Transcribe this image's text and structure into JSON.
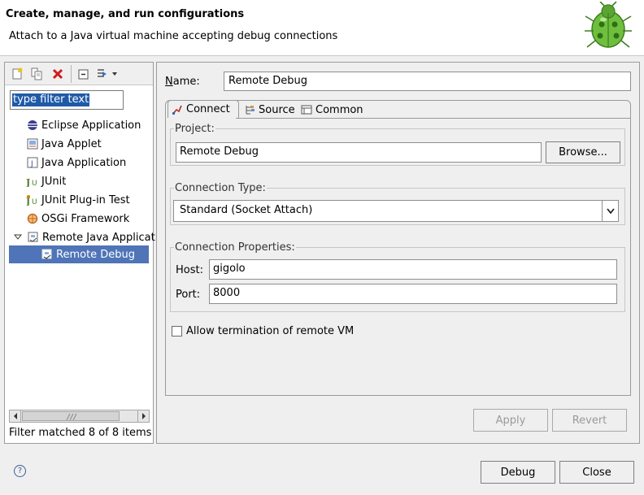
{
  "header": {
    "title": "Create, manage, and run configurations",
    "message": "Attach to a Java virtual machine accepting debug connections"
  },
  "left": {
    "filter_placeholder": "type filter text",
    "tree": [
      {
        "label": "Eclipse Application",
        "icon": "eclipse-app-icon"
      },
      {
        "label": "Java Applet",
        "icon": "java-applet-icon"
      },
      {
        "label": "Java Application",
        "icon": "java-app-icon"
      },
      {
        "label": "JUnit",
        "icon": "junit-icon"
      },
      {
        "label": "JUnit Plug-in Test",
        "icon": "junit-plugin-icon"
      },
      {
        "label": "OSGi Framework",
        "icon": "osgi-icon"
      },
      {
        "label": "Remote Java Applicati",
        "icon": "remote-java-icon"
      },
      {
        "label": "Remote Debug",
        "icon": "remote-debug-icon"
      }
    ],
    "status": "Filter matched 8 of 8 items"
  },
  "right": {
    "name_label": "Name:",
    "name_value": "Remote Debug",
    "tabs": [
      {
        "label": "Connect"
      },
      {
        "label": "Source"
      },
      {
        "label": "Common"
      }
    ],
    "project": {
      "label": "Project:",
      "value": "Remote Debug",
      "browse": "Browse..."
    },
    "connection_type": {
      "label": "Connection Type:",
      "value": "Standard (Socket Attach)"
    },
    "connection_props": {
      "label": "Connection Properties:",
      "host_label": "Host:",
      "host_value": "gigolo",
      "port_label": "Port:",
      "port_value": "8000"
    },
    "allow_termination": "Allow termination of remote VM",
    "apply": "Apply",
    "revert": "Revert"
  },
  "footer": {
    "debug": "Debug",
    "close": "Close"
  },
  "colors": {
    "selection": "#4f74b7",
    "filter_highlight": "#1f5aa8"
  }
}
